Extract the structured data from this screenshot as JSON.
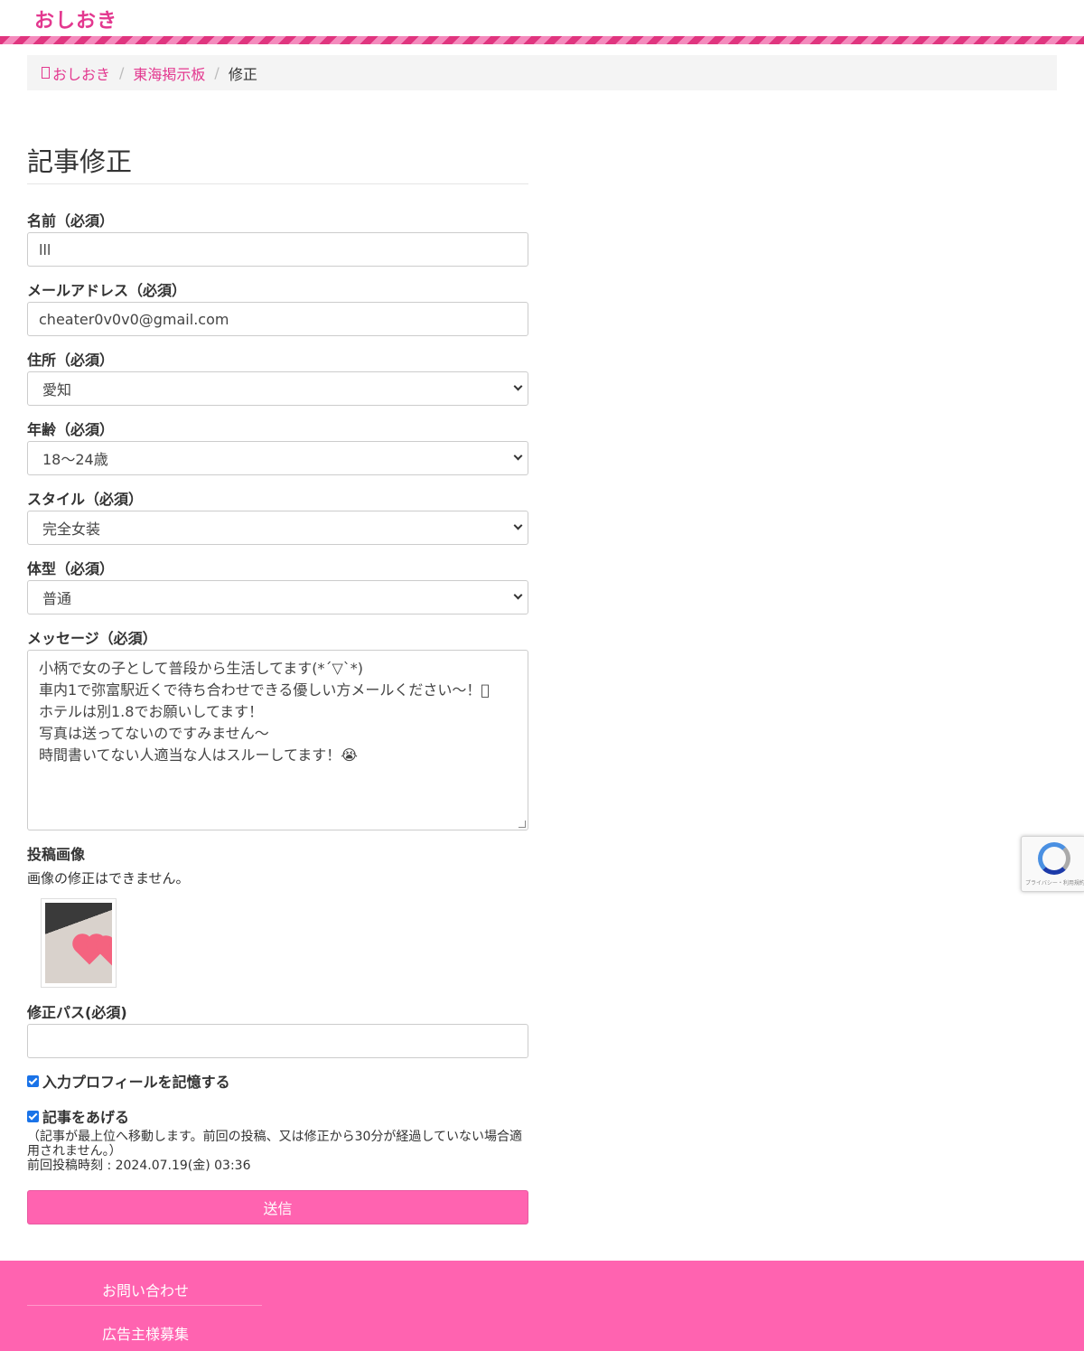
{
  "header": {
    "logo": "おしおき"
  },
  "breadcrumb": {
    "home": "おしおき",
    "board": "東海掲示板",
    "current": "修正"
  },
  "page_title": "記事修正",
  "form": {
    "name": {
      "label": "名前（必須）",
      "value": "lll"
    },
    "email": {
      "label": "メールアドレス（必須）",
      "value": "cheater0v0v0@gmail.com"
    },
    "address": {
      "label": "住所（必須）",
      "value": "愛知"
    },
    "age": {
      "label": "年齢（必須）",
      "value": "18〜24歳"
    },
    "style": {
      "label": "スタイル（必須）",
      "value": "完全女装"
    },
    "body_type": {
      "label": "体型（必須）",
      "value": "普通"
    },
    "message": {
      "label": "メッセージ（必須）",
      "lines": [
        "小柄で女の子として普段から生活してます(*´▽`*)",
        "車内1で弥富駅近くで待ち合わせできる優しい方メールください〜！􀀀",
        "ホテルは別1.8でお願いしてます！",
        "写真は送ってないのですみません〜",
        "時間書いてない人適当な人はスルーしてます！😭"
      ]
    },
    "image": {
      "label": "投稿画像",
      "note": "画像の修正はできません。"
    },
    "edit_pass": {
      "label": "修正パス(必須)",
      "value": ""
    },
    "remember_profile": {
      "label": "入力プロフィールを記憶する",
      "checked": true
    },
    "bump_post": {
      "label": "記事をあげる",
      "checked": true,
      "note_line1": "（記事が最上位へ移動します。前回の投稿、又は修正から30分が経過していない場合適",
      "note_line2": "用されません。）",
      "last_post": "前回投稿時刻 : 2024.07.19(金) 03:36"
    },
    "submit_label": "送信"
  },
  "recaptcha": {
    "text": "プライバシー・利用規約"
  },
  "footer": {
    "links": [
      "お問い合わせ",
      "広告主様募集"
    ]
  },
  "colors": {
    "brand": "#e3388f",
    "submit": "#ff63b0",
    "footer": "#ff63b0"
  }
}
